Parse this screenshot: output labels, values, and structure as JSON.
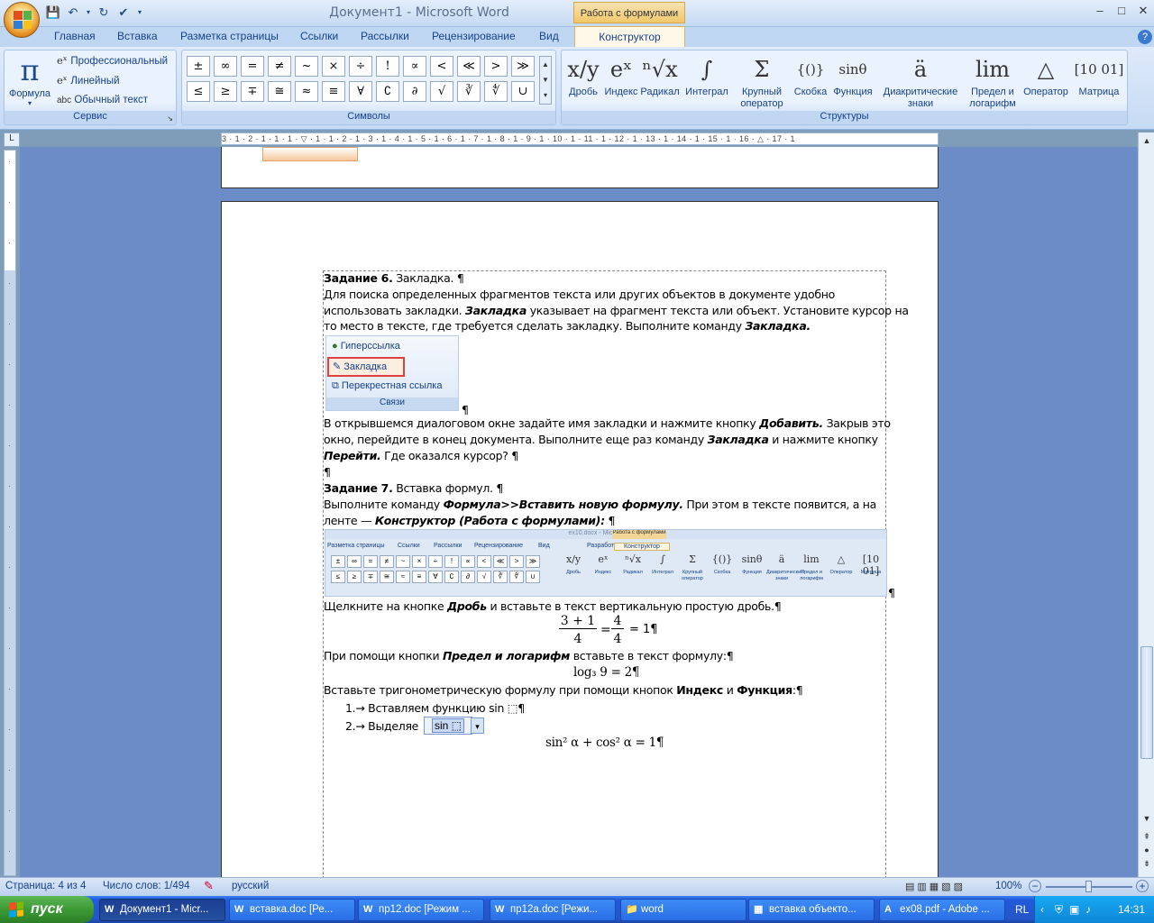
{
  "window": {
    "title": "Документ1 - Microsoft Word",
    "context_tab_group": "Работа с формулами",
    "min": "–",
    "max": "□",
    "close": "✕",
    "help": "?"
  },
  "tabs": [
    "Главная",
    "Вставка",
    "Разметка страницы",
    "Ссылки",
    "Рассылки",
    "Рецензирование",
    "Вид"
  ],
  "active_tab": "Конструктор",
  "tools": {
    "formula_label": "Формула",
    "pro_label": "Профессиональный",
    "linear_label": "Линейный",
    "plain_label": "Обычный текст",
    "plain_icon": "abc",
    "group_label": "Сервис",
    "symbols_label": "Символы",
    "symbols": [
      "±",
      "∞",
      "=",
      "≠",
      "~",
      "×",
      "÷",
      "!",
      "∝",
      "<",
      "≪",
      ">",
      "≫",
      "≤",
      "≥",
      "∓",
      "≅",
      "≈",
      "≡",
      "∀",
      "∁",
      "∂",
      "√",
      "∛",
      "∜",
      "∪"
    ],
    "structures_label": "Структуры",
    "structures": [
      {
        "icon": "x/y",
        "label": "Дробь"
      },
      {
        "icon": "eˣ",
        "label": "Индекс"
      },
      {
        "icon": "ⁿ√x",
        "label": "Радикал"
      },
      {
        "icon": "∫",
        "label": "Интеграл"
      },
      {
        "icon": "Σ",
        "label": "Крупный оператор"
      },
      {
        "icon": "{()}",
        "label": "Скобка"
      },
      {
        "icon": "sinθ",
        "label": "Функция"
      },
      {
        "icon": "ä",
        "label": "Диакритические знаки"
      },
      {
        "icon": "lim",
        "label": "Предел и логарифм"
      },
      {
        "icon": "△",
        "label": "Оператор"
      },
      {
        "icon": "[10 01]",
        "label": "Матрица"
      }
    ]
  },
  "doc": {
    "l1": "Задание 6. Закладка. ¶",
    "l2": "Для поиска определенных фрагментов текста или других объектов в документе удобно",
    "l3": "использовать закладки. Закладка указывает на фрагмент текста или объект. Установите курсор на",
    "l4": "то место в тексте, где требуется сделать закладку. Выполните команду Закладка.",
    "links_items": [
      "Гиперссылка",
      "Закладка",
      "Перекрестная ссылка"
    ],
    "links_group": "Связи",
    "l5": "В открывшемся диалоговом окне задайте имя закладки и нажмите кнопку Добавить. Закрыв это",
    "l6": "окно, перейдите в конец документа. Выполните еще раз команду Закладка и нажмите кнопку",
    "l7": "Перейти. Где оказался курсор? ¶",
    "l8": "¶",
    "l9": "Задание 7. Вставка формул. ¶",
    "l10": "Выполните команду Формула>>Вставить новую формулу. При этом в тексте появится, а на",
    "l11": "ленте — Конструктор (Работа с формулами): ¶",
    "mini_title": "ex10.docx - Microsoft Word",
    "mini_ctx": "Работа с формулами",
    "mini_tabs": [
      "Разметка страницы",
      "Ссылки",
      "Рассылки",
      "Рецензирование",
      "Вид",
      "Разработчик",
      "Конструктор"
    ],
    "l12": "Щелкните на кнопке Дробь и вставьте в текст вертикальную простую дробь.¶",
    "f1_num": "3 + 1",
    "f1_den": "4",
    "f1_mid": "=",
    "f1_num2": "4",
    "f1_den2": "4",
    "f1_end": "= 1¶",
    "l13": "При помощи кнопки Предел и логарифм вставьте в текст формулу:¶",
    "f2": "log₃ 9 = 2¶",
    "l14": "Вставьте тригонометрическую формулу при помощи кнопок Индекс и Функция:¶",
    "li1": "1.→ Вставляем функцию sin ⬚¶",
    "li2": "2.→ Выделяе",
    "li2_eq": "sin ⬚",
    "f3": "sin² α + cos² α = 1¶"
  },
  "status": {
    "page": "Страница: 4 из 4",
    "words": "Число слов: 1/494",
    "lang": "русский",
    "zoom": "100%"
  },
  "taskbar": {
    "start": "пуск",
    "items": [
      "Документ1 - Micr...",
      "вставка.doc [Ре...",
      "пр12.doc [Режим ...",
      "пр12a.doc [Режи...",
      "word",
      "вставка объекто...",
      "ex08.pdf - Adobe ..."
    ],
    "lang": "RL",
    "clock": "14:31"
  },
  "ruler_h": "3 · 1 · 2 · 1 · 1 · 1 · ▽ · 1 · 1 · 2 · 1 · 3 · 1 · 4 · 1 · 5 · 1 · 6 · 1 · 7 · 1 · 8 · 1 · 9 · 1 · 10 · 1 · 11 · 1 · 12 · 1 · 13 · 1 · 14 · 1 · 15 · 1 · 16 · △ · 17 · 1",
  "ruler_corner": "L"
}
